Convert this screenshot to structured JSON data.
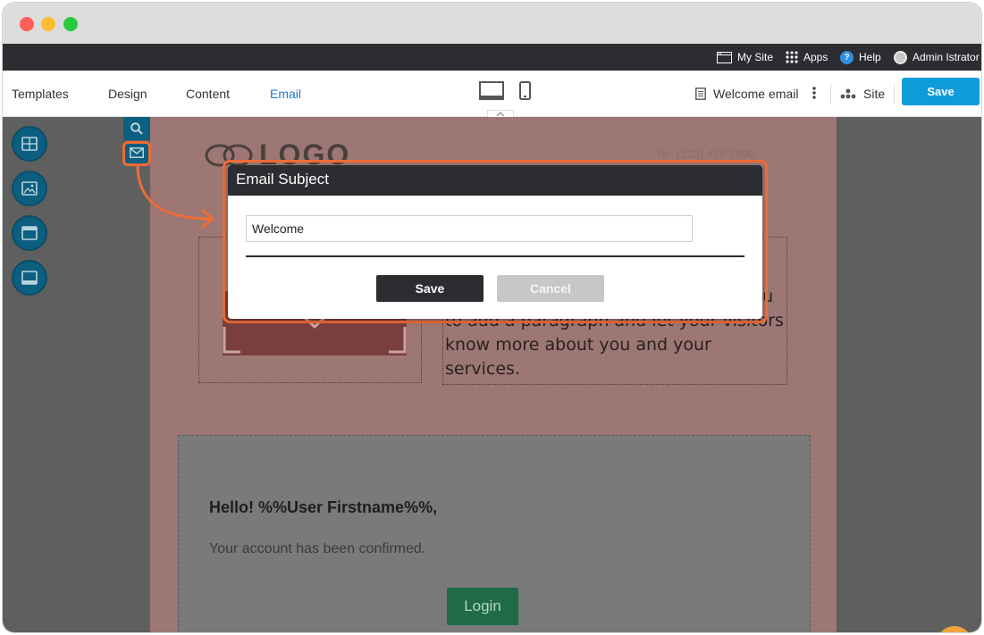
{
  "window": {
    "controls": [
      "close",
      "minimize",
      "maximize"
    ]
  },
  "adminbar": {
    "my_site": "My Site",
    "apps": "Apps",
    "help": "Help",
    "help_glyph": "?",
    "user": "Admin Istrator"
  },
  "toolbar": {
    "tabs": [
      "Templates",
      "Design",
      "Content",
      "Email"
    ],
    "active_tab": "Email",
    "page_name": "Welcome email",
    "site": "Site",
    "save": "Save"
  },
  "canvas": {
    "logo_text": "LOGO",
    "tel": "Tel. (123) 456 7890",
    "body_text": "here. This is an excellent place for you to add a paragraph and let your visitors know more about you and your services.",
    "hello": "Hello! %%User Firstname%%,",
    "confirmed": "Your account has been confirmed.",
    "login": "Login"
  },
  "dialog": {
    "title": "Email Subject",
    "subject_value": "Welcome",
    "save": "Save",
    "cancel": "Cancel"
  },
  "colors": {
    "accent": "#0e9bdc",
    "active_tab": "#1e7ac7",
    "highlight": "#ef6c36",
    "dark": "#2b2d31"
  }
}
